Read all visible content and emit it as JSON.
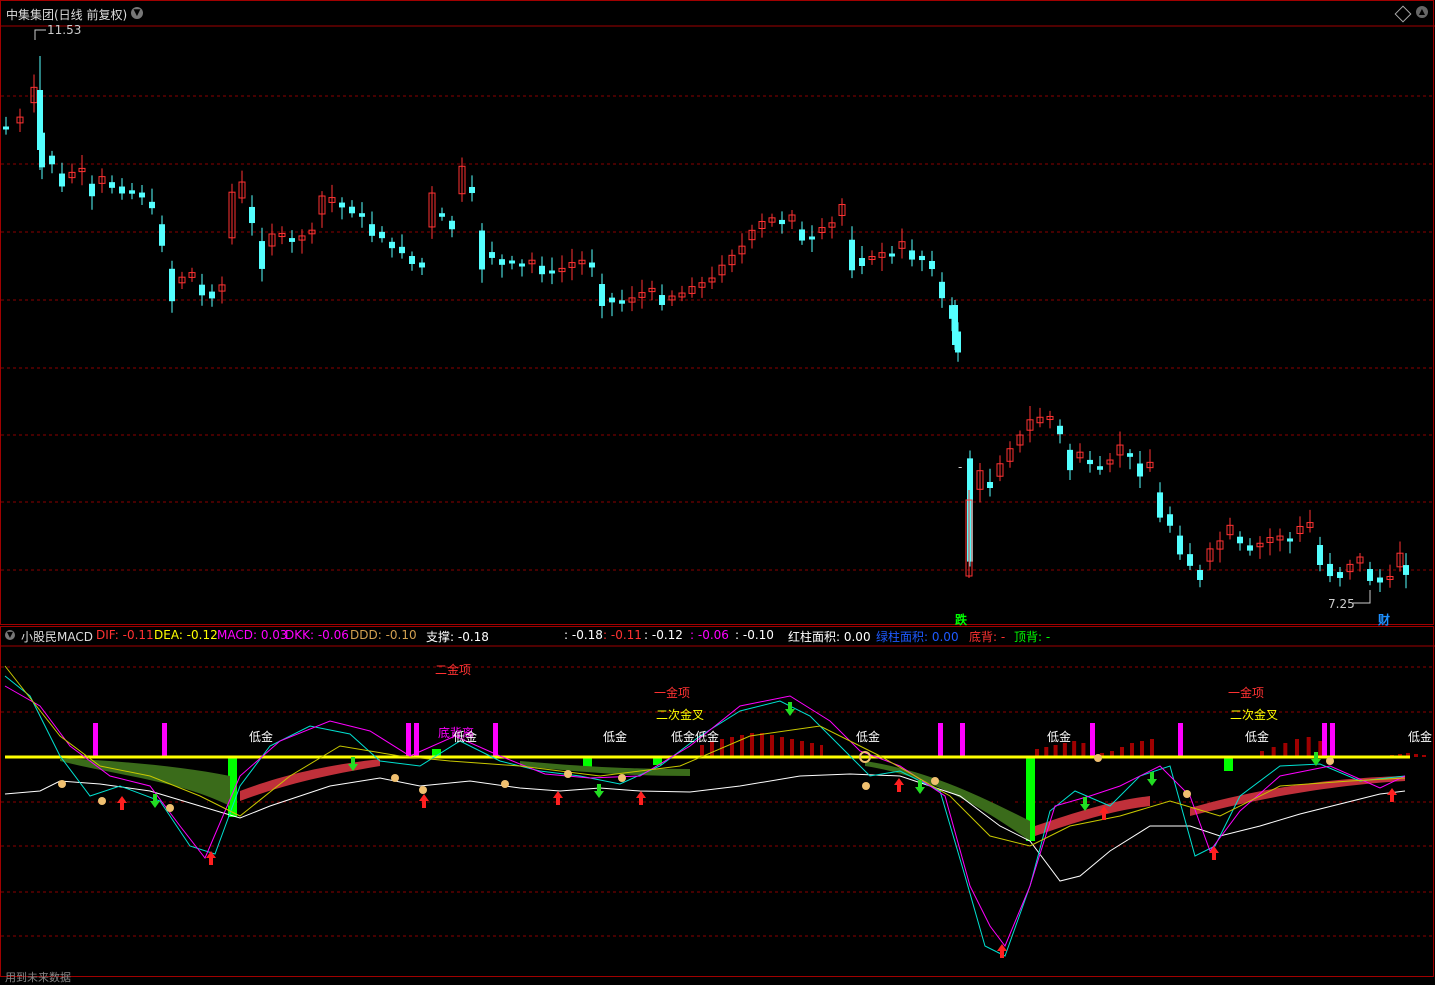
{
  "main_header": {
    "title": "中集集团(日线 前复权)",
    "dropdown_icon": "chevron-down-icon",
    "right_icons": [
      "diamond-icon",
      "chevron-up-circle-icon",
      "chevron-down-circle-icon"
    ]
  },
  "main_chart": {
    "high_label": "11.53",
    "low_label": "7.25",
    "marker_die": "跌",
    "marker_cai": "财",
    "dash_label": "-"
  },
  "indicator_header": {
    "name": "小股民MACD",
    "dif": "DIF: -0.11",
    "dea": "DEA: -0.12",
    "macd": "MACD: 0.03",
    "dkk": "DKK: -0.06",
    "ddd": "DDD: -0.10",
    "support": "支撑: -0.18",
    "v1": ": -0.18",
    "v2": ": -0.11",
    "v3": ": -0.12",
    "v4": ": -0.06",
    "v5": ": -0.10",
    "red_area": "红柱面积: 0.00",
    "green_area": "绿柱面积: 0.00",
    "bottom_div": "底背: -",
    "top_div": "顶背: -"
  },
  "indicator_labels": {
    "erjin_top_1": "二金项",
    "yijin_top_1": "一金项",
    "erci_jincha_1": "二次金叉",
    "yijin_top_2": "一金项",
    "erci_jincha_2": "二次金叉",
    "dijin": "低金",
    "dijin_pink": "底背离",
    "dijin_overlap": "低金低金"
  },
  "footer": {
    "status": "用到未来数据"
  },
  "colors": {
    "up": "#ff3232",
    "down": "#54ffff",
    "grid": "#8b0000",
    "yellow_line": "#ffff00",
    "magenta": "#ff00ff",
    "green_bar": "#00ff00",
    "blue_bar": "#1e90ff",
    "tan_bar": "#d2a050",
    "dark_red_bar": "#a00000",
    "white_bar": "#ffffff"
  }
}
